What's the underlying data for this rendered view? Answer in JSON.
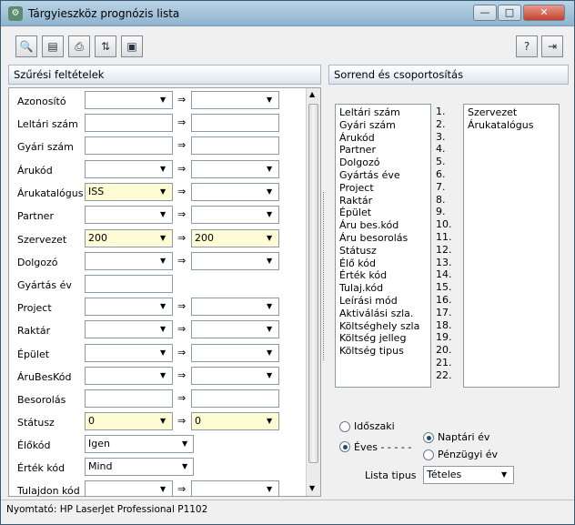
{
  "window": {
    "title": "Tárgyieszköz prognózis lista",
    "minimize": "—",
    "maximize": "□",
    "close": "✕"
  },
  "toolbar": {
    "buttons": [
      "preview-icon",
      "settings-icon",
      "print-icon",
      "export-icon",
      "save-icon"
    ],
    "help_icon": "help-icon",
    "exit_icon": "exit-icon"
  },
  "filters": {
    "header": "Szűrési feltételek",
    "rows": [
      {
        "label": "Azonosító",
        "from": "",
        "to": ""
      },
      {
        "label": "Leltári szám",
        "from": "",
        "to": ""
      },
      {
        "label": "Gyári szám",
        "from": "",
        "to": ""
      },
      {
        "label": "Árukód",
        "from": "",
        "to": ""
      },
      {
        "label": "Árukatalógus",
        "from": "ISS",
        "to": ""
      },
      {
        "label": "Partner",
        "from": "",
        "to": ""
      },
      {
        "label": "Szervezet",
        "from": "200",
        "to": "200"
      },
      {
        "label": "Dolgozó",
        "from": "",
        "to": ""
      },
      {
        "label": "Gyártás év",
        "from": "",
        "to": ""
      },
      {
        "label": "Project",
        "from": "",
        "to": ""
      },
      {
        "label": "Raktár",
        "from": "",
        "to": ""
      },
      {
        "label": "Épület",
        "from": "",
        "to": ""
      },
      {
        "label": "ÁruBesKód",
        "from": "",
        "to": ""
      },
      {
        "label": "Besorolás",
        "from": "",
        "to": ""
      },
      {
        "label": "Státusz",
        "from": "0",
        "to": "0"
      },
      {
        "label": "Élőkód",
        "from": "Igen",
        "to": ""
      },
      {
        "label": "Érték kód",
        "from": "Mind",
        "to": ""
      },
      {
        "label": "Tulajdon kód",
        "from": "",
        "to": ""
      }
    ]
  },
  "sorting": {
    "header": "Sorrend és csoportosítás",
    "available": [
      "Leltári szám",
      "Gyári szám",
      "Árukód",
      "Partner",
      "Dolgozó",
      "Gyártás éve",
      "Project",
      "Raktár",
      "Épület",
      "Áru bes.kód",
      "Áru besorolás",
      "Státusz",
      "Élő kód",
      "Érték kód",
      "Tulaj.kód",
      "Leírási mód",
      "Aktiválási szla.",
      "Költséghely szla",
      "Költség jelleg",
      "Költség tipus"
    ],
    "numbers": [
      "1.",
      "2.",
      "3.",
      "4.",
      "5.",
      "6.",
      "7.",
      "8.",
      "9.",
      "10.",
      "11.",
      "12.",
      "13.",
      "14.",
      "15.",
      "16.",
      "17.",
      "18.",
      "19.",
      "20.",
      "21.",
      "22."
    ],
    "selected": [
      "Szervezet",
      "Árukatalógus"
    ]
  },
  "options": {
    "idoszaki": "Időszaki",
    "eves": "Éves - - - - -",
    "naptari": "Naptári év",
    "penzugyi": "Pénzügyi év",
    "lista_label": "Lista tipus",
    "lista_value": "Tételes"
  },
  "status": {
    "printer": "Nyomtató: HP LaserJet Professional P1102"
  }
}
